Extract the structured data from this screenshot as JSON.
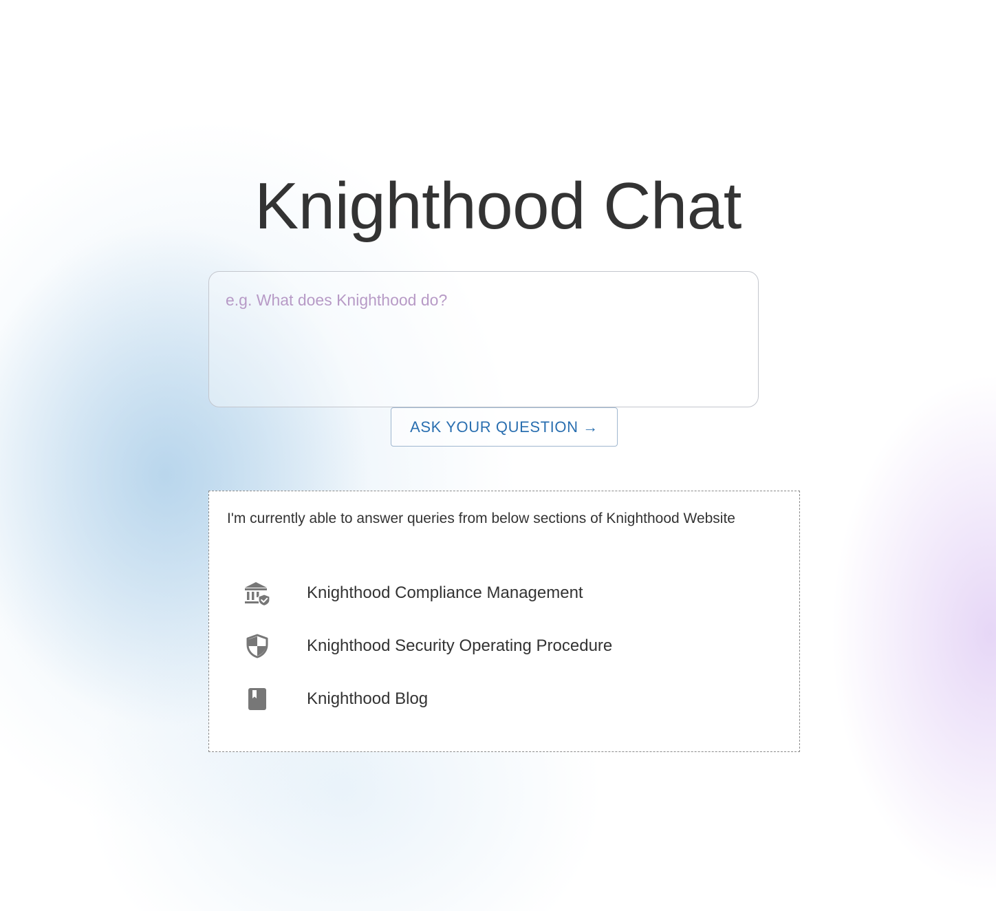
{
  "page": {
    "title": "Knighthood Chat"
  },
  "question": {
    "placeholder": "e.g. What does Knighthood do?",
    "value": "",
    "ask_label": "ASK YOUR QUESTION →"
  },
  "sources": {
    "intro": "I'm currently able to answer queries from below sections of Knighthood Website",
    "items": [
      {
        "label": "Knighthood Compliance Management",
        "icon": "bank-shield-icon"
      },
      {
        "label": "Knighthood Security Operating Procedure",
        "icon": "shield-icon"
      },
      {
        "label": "Knighthood Blog",
        "icon": "book-icon"
      }
    ]
  },
  "colors": {
    "icon": "#777777",
    "button_text": "#2a6fb0",
    "placeholder": "#b79ac6"
  }
}
